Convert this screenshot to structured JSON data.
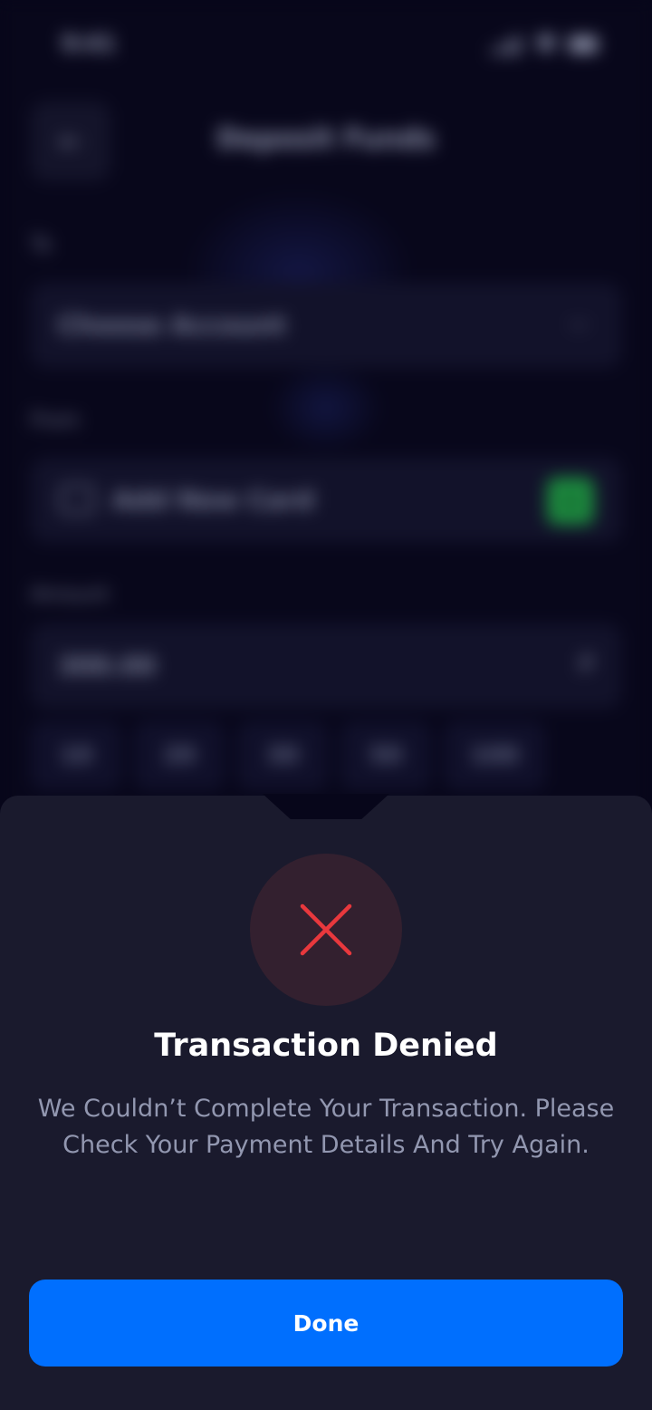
{
  "background": {
    "status_bar": {
      "time": "9:41"
    },
    "header": {
      "back_icon": "arrow-left-icon",
      "title": "Deposit Funds"
    },
    "to": {
      "label": "To",
      "placeholder": "Choose Account",
      "icon": "chevron-down-icon"
    },
    "from": {
      "label": "From",
      "card_text": "Add New Card",
      "card_icon": "card-icon",
      "add_icon": "plus-icon"
    },
    "amount": {
      "label": "Amount",
      "value": "300.00",
      "currency": "₽"
    },
    "quick_amounts": [
      "10",
      "20",
      "30",
      "50",
      "100"
    ]
  },
  "dialog": {
    "icon": "close-x-icon",
    "title": "Transaction Denied",
    "message": "We Couldn’t Complete Your Transaction. Please Check Your Payment Details And Try Again.",
    "button_label": "Done"
  },
  "colors": {
    "sheet": "#1a1a2d",
    "error_circle": "#33202f",
    "error_x": "#e8383d",
    "primary_button": "#006ffe",
    "add_card_green": "#1c8a3e"
  }
}
